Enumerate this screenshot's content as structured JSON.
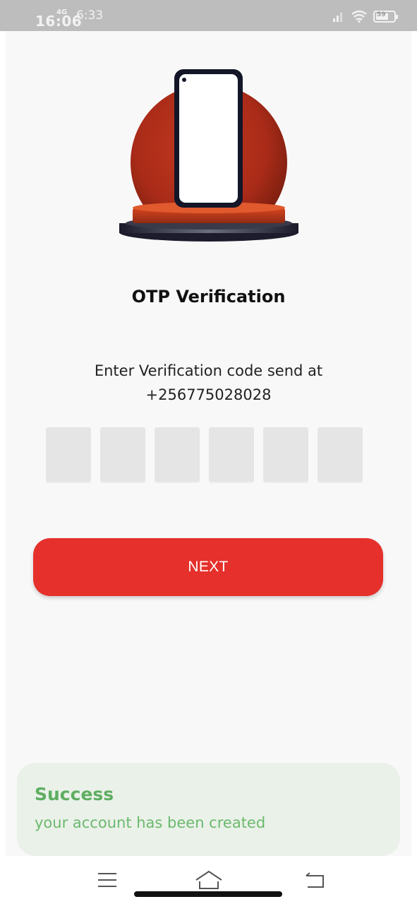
{
  "status_bar": {
    "time": "16:06",
    "network": "4G",
    "secondary_time": "6:33",
    "battery": "59"
  },
  "page": {
    "title": "OTP Verification",
    "instruction": "Enter Verification code send at",
    "phone": "+256775028028"
  },
  "otp": {
    "digits": [
      "",
      "",
      "",
      "",
      "",
      ""
    ]
  },
  "actions": {
    "next_label": "NEXT"
  },
  "toast": {
    "title": "Success",
    "message": "your account has been created"
  },
  "colors": {
    "primary": "#e5302b",
    "success_bg": "#eaf1e9",
    "success_text": "#5fae62",
    "otp_box": "#e5e5e5",
    "podium": "#b8321f"
  },
  "icons": {
    "hero": "phone-on-podium-illustration",
    "nav_left": "menu-icon",
    "nav_center": "home-icon",
    "nav_right": "back-icon"
  }
}
